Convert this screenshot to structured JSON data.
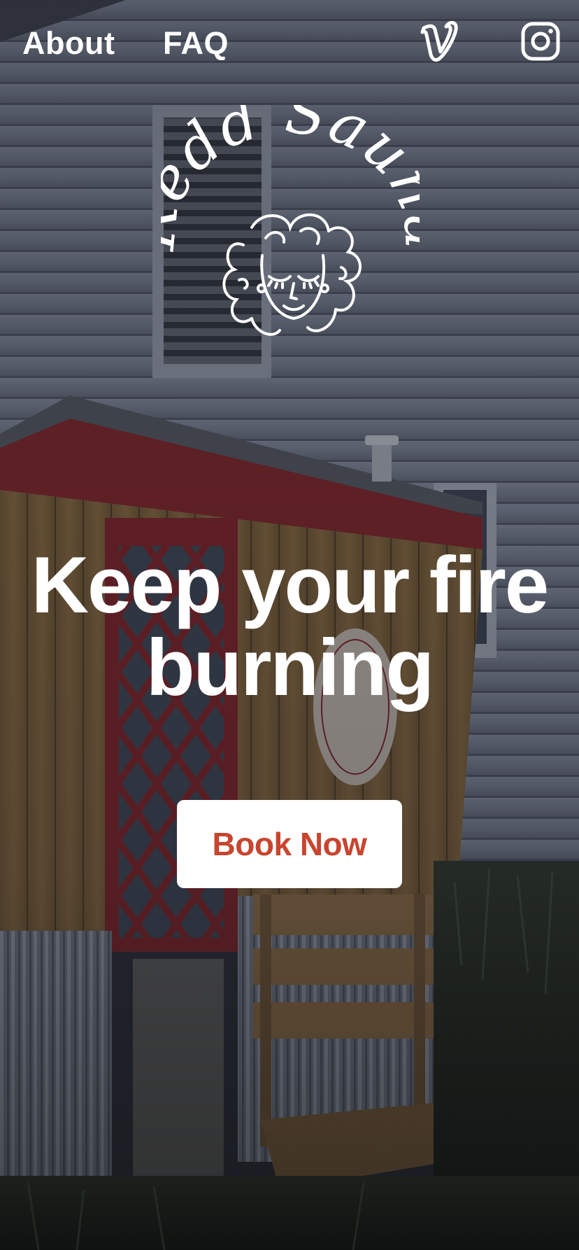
{
  "nav": {
    "about_label": "About",
    "faq_label": "FAQ",
    "social": [
      {
        "name": "vimeo",
        "icon": "vimeo-icon"
      },
      {
        "name": "instagram",
        "icon": "instagram-icon"
      }
    ]
  },
  "brand": {
    "logo_text": "Redd Sauna",
    "logo_icon": "woman-face-curly-hair-illustration"
  },
  "hero": {
    "headline": "Keep your fire burning",
    "cta_label": "Book Now"
  },
  "colors": {
    "accent": "#c8452f",
    "text_on_dark": "#ffffff",
    "button_bg": "#ffffff"
  }
}
